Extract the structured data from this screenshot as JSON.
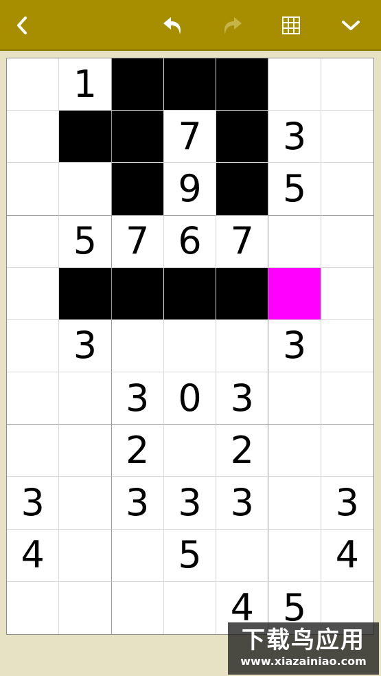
{
  "toolbar": {
    "icons": [
      "back-arrow-icon",
      "undo-icon",
      "redo-icon",
      "grid-icon",
      "chevron-down-icon"
    ],
    "colors": {
      "bar": "#a68e00",
      "icon": "#ffffff",
      "disabled_icon": "#c6b449"
    }
  },
  "board": {
    "rows": 11,
    "cols": 7,
    "colors": {
      "black": "#000000",
      "selected": "#ff00ff",
      "white": "#ffffff"
    },
    "cells": [
      [
        {
          "v": ""
        },
        {
          "v": "1"
        },
        {
          "b": 1
        },
        {
          "b": 1
        },
        {
          "b": 1
        },
        {
          "v": ""
        },
        {
          "v": ""
        }
      ],
      [
        {
          "v": ""
        },
        {
          "b": 1
        },
        {
          "b": 1
        },
        {
          "v": "7"
        },
        {
          "b": 1
        },
        {
          "v": "3"
        },
        {
          "v": ""
        }
      ],
      [
        {
          "v": ""
        },
        {
          "v": ""
        },
        {
          "b": 1
        },
        {
          "v": "9"
        },
        {
          "b": 1
        },
        {
          "v": "5"
        },
        {
          "v": ""
        }
      ],
      [
        {
          "v": ""
        },
        {
          "v": "5"
        },
        {
          "v": "7"
        },
        {
          "v": "6"
        },
        {
          "v": "7"
        },
        {
          "v": ""
        },
        {
          "v": ""
        }
      ],
      [
        {
          "v": ""
        },
        {
          "b": 1
        },
        {
          "b": 1
        },
        {
          "b": 1
        },
        {
          "b": 1
        },
        {
          "s": 1
        },
        {
          "v": ""
        }
      ],
      [
        {
          "v": ""
        },
        {
          "v": "3"
        },
        {
          "v": ""
        },
        {
          "v": ""
        },
        {
          "v": ""
        },
        {
          "v": "3"
        },
        {
          "v": ""
        }
      ],
      [
        {
          "v": ""
        },
        {
          "v": ""
        },
        {
          "v": "3"
        },
        {
          "v": "0"
        },
        {
          "v": "3"
        },
        {
          "v": ""
        },
        {
          "v": ""
        }
      ],
      [
        {
          "v": ""
        },
        {
          "v": ""
        },
        {
          "v": "2"
        },
        {
          "v": ""
        },
        {
          "v": "2"
        },
        {
          "v": ""
        },
        {
          "v": ""
        }
      ],
      [
        {
          "v": "3"
        },
        {
          "v": ""
        },
        {
          "v": "3"
        },
        {
          "v": "3"
        },
        {
          "v": "3"
        },
        {
          "v": ""
        },
        {
          "v": "3"
        }
      ],
      [
        {
          "v": "4"
        },
        {
          "v": ""
        },
        {
          "v": ""
        },
        {
          "v": "5"
        },
        {
          "v": ""
        },
        {
          "v": ""
        },
        {
          "v": "4"
        }
      ],
      [
        {
          "v": ""
        },
        {
          "v": ""
        },
        {
          "v": ""
        },
        {
          "v": ""
        },
        {
          "v": "4"
        },
        {
          "v": "5"
        },
        {
          "v": ""
        }
      ]
    ]
  },
  "watermark": {
    "title": "下载鸟应用",
    "url": "www.xiazainiao.com"
  }
}
